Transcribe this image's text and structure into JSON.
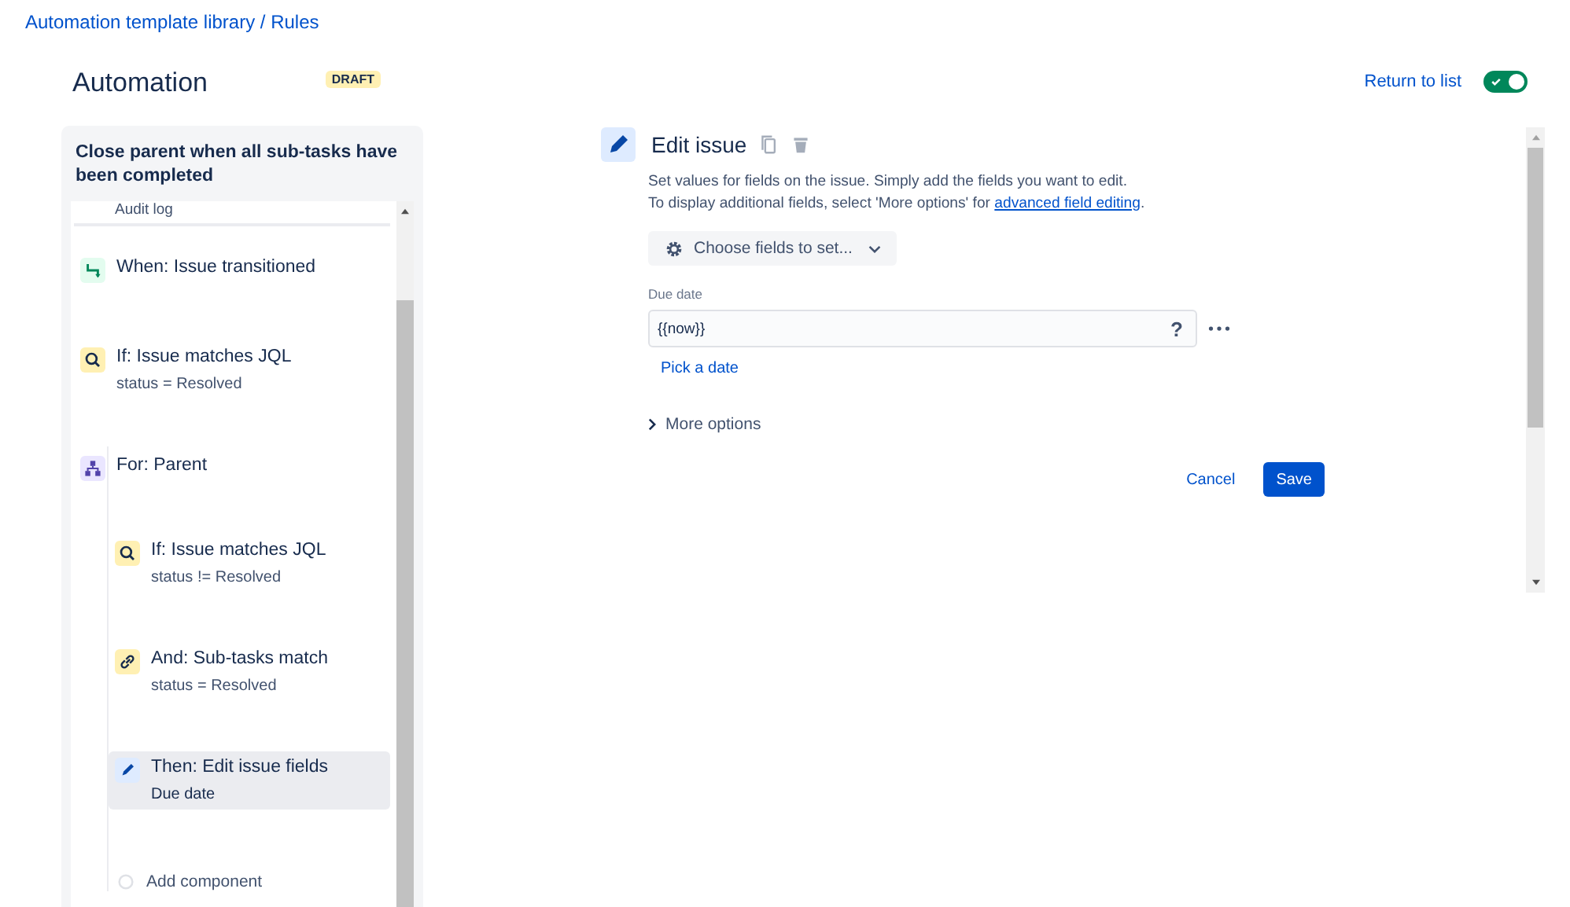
{
  "breadcrumb": "Automation template library / Rules",
  "header": {
    "title": "Automation",
    "badge": "DRAFT",
    "return_link": "Return to list",
    "rule_toggle": {
      "on": true
    }
  },
  "rule_panel": {
    "title": "Close parent when all sub-tasks have been completed",
    "audit_log": "Audit log",
    "steps": [
      {
        "kind": "trigger",
        "title": "When: Issue transitioned",
        "selected": false
      },
      {
        "kind": "condition",
        "title": "If: Issue matches JQL",
        "detail": "status = Resolved",
        "selected": false
      },
      {
        "kind": "branch",
        "title": "For: Parent",
        "selected": false,
        "children": [
          {
            "kind": "condition",
            "title": "If: Issue matches JQL",
            "detail": "status != Resolved",
            "selected": false
          },
          {
            "kind": "related",
            "title": "And: Sub-tasks match",
            "detail": "status = Resolved",
            "selected": false
          },
          {
            "kind": "action",
            "title": "Then: Edit issue fields",
            "detail": "Due date",
            "selected": true
          },
          {
            "kind": "add",
            "title": "Add component"
          }
        ]
      }
    ]
  },
  "editor": {
    "title": "Edit issue",
    "description_line_1": "Set values for fields on the issue. Simply add the fields you want to edit.",
    "description_line_2": "To display additional fields, select 'More options' for",
    "description_link": "advanced field editing",
    "description_end": ".",
    "choose_fields_button": "Choose fields to set...",
    "field": {
      "label": "Due date",
      "value": "{{now}}",
      "help": "?"
    },
    "pick_date_link": "Pick a date",
    "more_options": {
      "label": "More options",
      "expanded": false
    },
    "buttons": {
      "cancel": "Cancel",
      "save": "Save"
    }
  }
}
